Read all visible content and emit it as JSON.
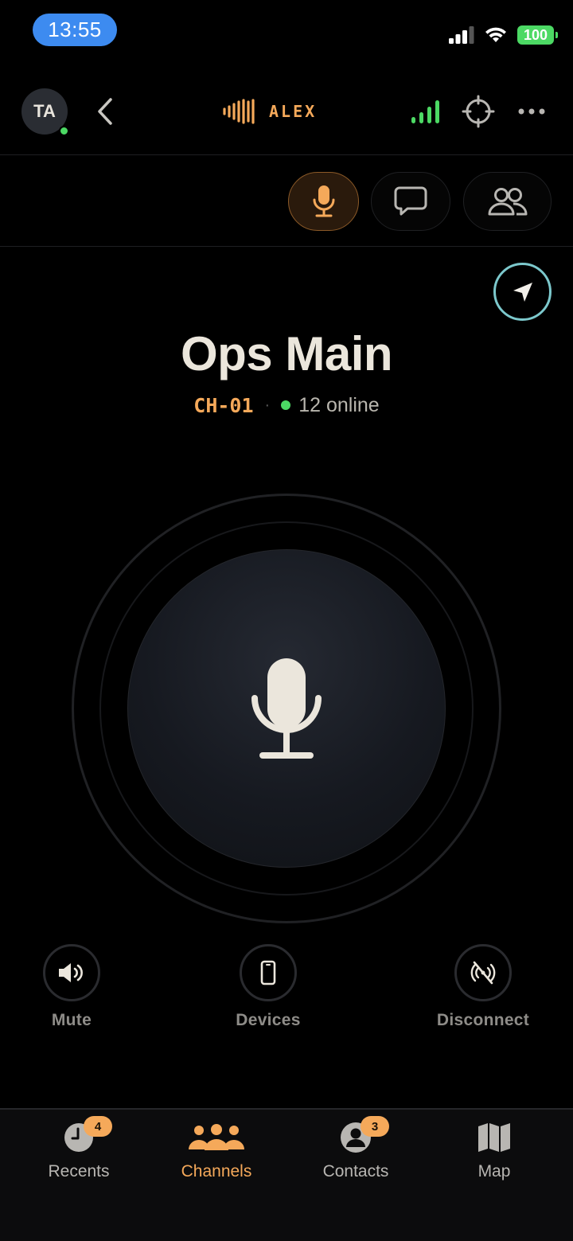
{
  "status_bar": {
    "time": "13:55",
    "battery": "100"
  },
  "header": {
    "avatar_initials": "TA",
    "brand_label": "ALEX"
  },
  "channel": {
    "name": "Ops Main",
    "code": "CH-01",
    "separator": "·",
    "online": "12 online"
  },
  "actions": [
    {
      "label": "Mute",
      "icon": "speaker-icon"
    },
    {
      "label": "Devices",
      "icon": "phone-icon"
    },
    {
      "label": "Disconnect",
      "icon": "no-signal-icon"
    }
  ],
  "tabs": [
    {
      "label": "Recents",
      "icon": "clock-icon",
      "badge": "4"
    },
    {
      "label": "Channels",
      "icon": "group-icon",
      "badge": ""
    },
    {
      "label": "Contacts",
      "icon": "person-icon",
      "badge": "3"
    },
    {
      "label": "Map",
      "icon": "map-icon",
      "badge": ""
    }
  ],
  "colors": {
    "accent": "#f5a95a",
    "online": "#4cd964",
    "status_time": "#3d8bf0",
    "nav_ring": "#7cc8cc"
  }
}
